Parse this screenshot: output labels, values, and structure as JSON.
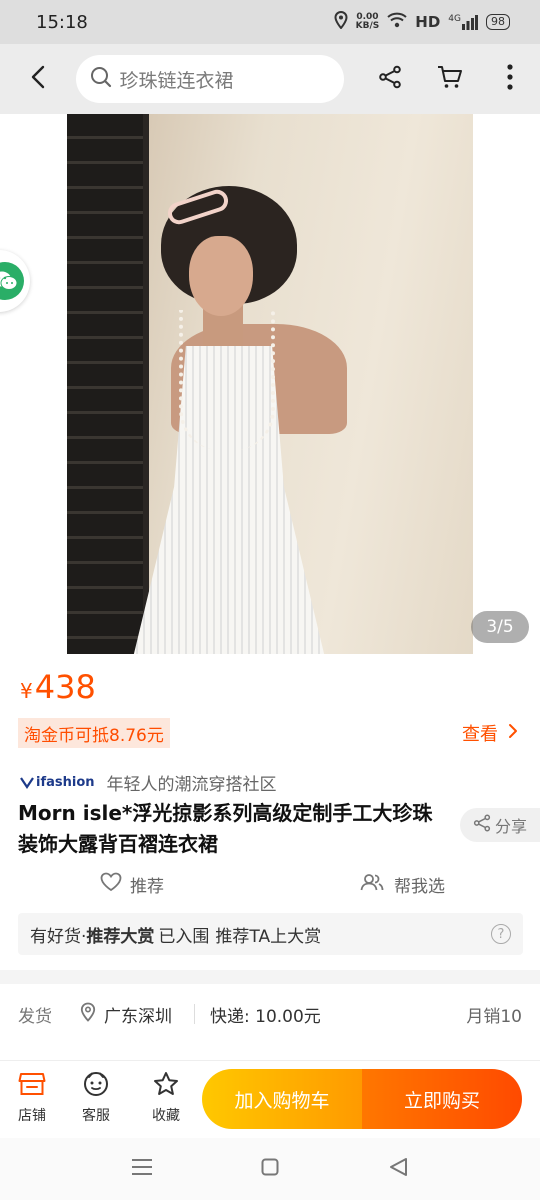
{
  "status_bar": {
    "time": "15:18",
    "net_speed": "0.00",
    "net_unit": "KB/S",
    "hd": "HD",
    "signal": "4G",
    "battery": "98"
  },
  "search": {
    "placeholder": "珍珠链连衣裙"
  },
  "gallery": {
    "counter": "3/5"
  },
  "product": {
    "currency": "¥",
    "price": "438",
    "coin_discount": "淘金币可抵8.76元",
    "view_label": "查看",
    "brand_logo": "ifashion",
    "brand_slogan": "年轻人的潮流穿搭社区",
    "title": "Morn isle*浮光掠影系列高级定制手工大珍珠装饰大露背百褶连衣裙",
    "share_label": "分享",
    "recommend_label": "推荐",
    "help_pick_label": "帮我选"
  },
  "award": {
    "prefix": "有好货·",
    "bold": "推荐大赏",
    "status": "已入围",
    "suffix": "推荐TA上大赏",
    "help_icon": "?"
  },
  "shipping": {
    "label": "发货",
    "location": "广东深圳",
    "fee": "快递: 10.00元",
    "monthly_sales": "月销10"
  },
  "bottom_bar": {
    "store_label": "店铺",
    "service_label": "客服",
    "favorite_label": "收藏",
    "add_cart_label": "加入购物车",
    "buy_now_label": "立即购买"
  },
  "colors": {
    "accent": "#ff5000",
    "cart_button": "#ffb400",
    "buy_button": "#ff5a00",
    "coin_tag_bg": "#fde7dc"
  },
  "icons": [
    "back-icon",
    "search-icon",
    "share-icon",
    "cart-icon",
    "more-icon",
    "wechat-icon",
    "heart-icon",
    "people-icon",
    "location-icon",
    "store-icon",
    "service-icon",
    "star-icon",
    "menu-icon",
    "home-icon",
    "nav-back-icon"
  ]
}
